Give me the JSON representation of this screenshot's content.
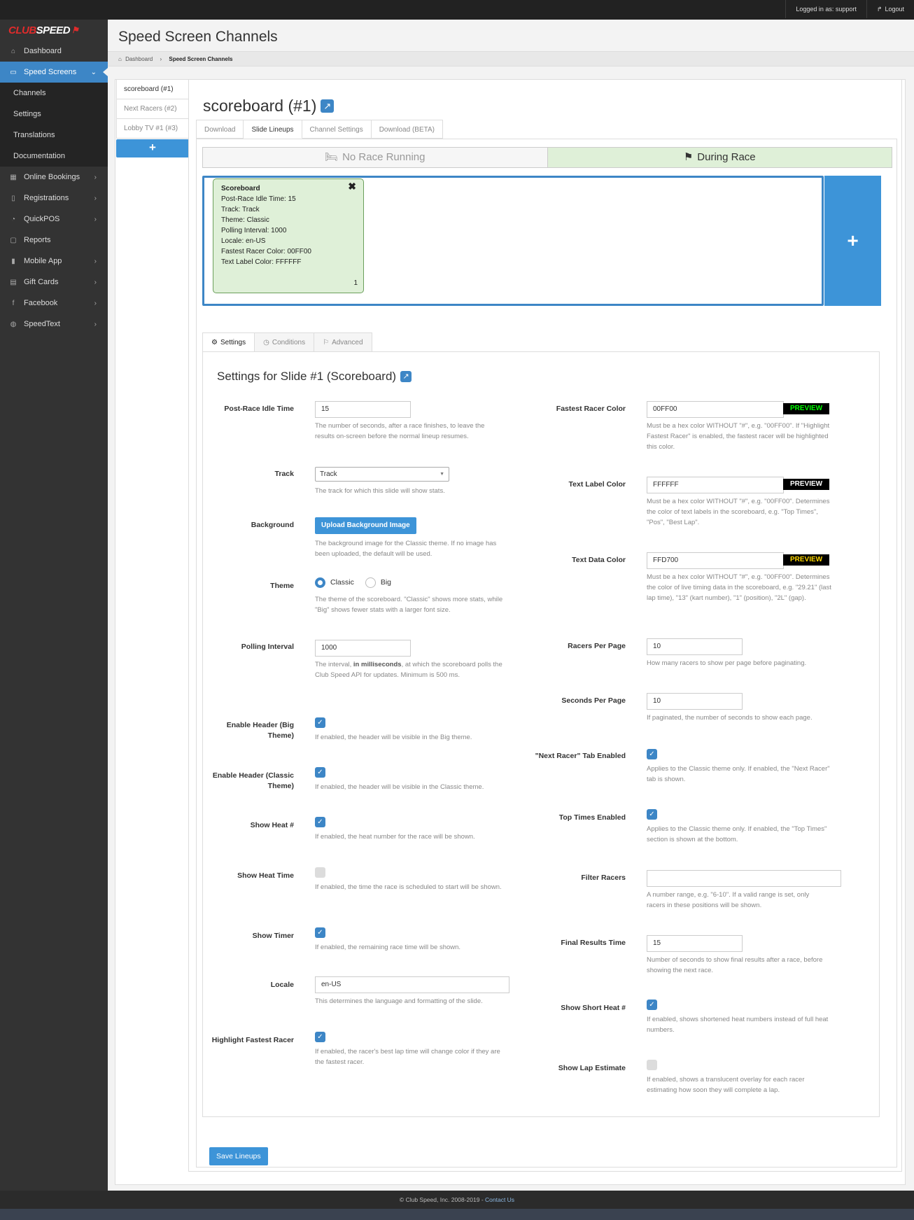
{
  "topbar": {
    "logged_in": "Logged in as: support",
    "logout": "Logout"
  },
  "logo": {
    "part1": "CLUB",
    "part2": "SPEED"
  },
  "sidebar": {
    "items": [
      {
        "label": "Dashboard",
        "icon": "home-icon",
        "glyph": "⌂"
      },
      {
        "label": "Speed Screens",
        "icon": "monitor-icon",
        "glyph": "▭"
      },
      {
        "label": "Channels"
      },
      {
        "label": "Settings"
      },
      {
        "label": "Translations"
      },
      {
        "label": "Documentation"
      },
      {
        "label": "Online Bookings",
        "icon": "calendar-icon",
        "glyph": "▦"
      },
      {
        "label": "Registrations",
        "icon": "tablet-icon",
        "glyph": "▯"
      },
      {
        "label": "QuickPOS",
        "icon": "dashboard-icon",
        "glyph": "◔"
      },
      {
        "label": "Reports",
        "icon": "file-icon",
        "glyph": "▢"
      },
      {
        "label": "Mobile App",
        "icon": "mobile-icon",
        "glyph": "▮"
      },
      {
        "label": "Gift Cards",
        "icon": "gift-card-icon",
        "glyph": "▤"
      },
      {
        "label": "Facebook",
        "icon": "facebook-icon",
        "glyph": "f"
      },
      {
        "label": "SpeedText",
        "icon": "chat-icon",
        "glyph": "◍"
      }
    ]
  },
  "page": {
    "title": "Speed Screen Channels"
  },
  "breadcrumb": {
    "home": "Dashboard",
    "current": "Speed Screen Channels"
  },
  "channels": [
    {
      "label": "scoreboard (#1)"
    },
    {
      "label": "Next Racers (#2)"
    },
    {
      "label": "Lobby TV #1 (#3)"
    }
  ],
  "channel": {
    "title": "scoreboard (#1)"
  },
  "subtabs": [
    "Download",
    "Slide Lineups",
    "Channel Settings",
    "Download (BETA)"
  ],
  "toggle": {
    "no_race": "No Race Running",
    "during": "During Race"
  },
  "card": {
    "title": "Scoreboard",
    "lines": [
      "Post-Race Idle Time: 15",
      "Track: Track",
      "Theme: Classic",
      "Polling Interval: 1000",
      "Locale: en-US",
      "Fastest Racer Color: 00FF00",
      "Text Label Color: FFFFFF"
    ],
    "number": "1"
  },
  "settings_tabs": [
    "Settings",
    "Conditions",
    "Advanced"
  ],
  "settings": {
    "title": "Settings for Slide #1 (Scoreboard)",
    "post_race_idle": {
      "label": "Post-Race Idle Time",
      "value": "15",
      "help": "The number of seconds, after a race finishes, to leave the results on-screen before the normal lineup resumes."
    },
    "track": {
      "label": "Track",
      "value": "Track",
      "help": "The track for which this slide will show stats."
    },
    "background": {
      "label": "Background",
      "button": "Upload Background Image",
      "help": "The background image for the Classic theme. If no image has been uploaded, the default will be used."
    },
    "theme": {
      "label": "Theme",
      "opt1": "Classic",
      "opt2": "Big",
      "help": "The theme of the scoreboard. \"Classic\" shows more stats, while \"Big\" shows fewer stats with a larger font size."
    },
    "polling": {
      "label": "Polling Interval",
      "value": "1000",
      "help1": "The interval, ",
      "help_bold": "in milliseconds",
      "help2": ", at which the scoreboard polls the Club Speed API for updates. Minimum is 500 ms."
    },
    "header_big": {
      "label": "Enable Header (Big Theme)",
      "help": "If enabled, the header will be visible in the Big theme."
    },
    "header_classic": {
      "label": "Enable Header (Classic Theme)",
      "help": "If enabled, the header will be visible in the Classic theme."
    },
    "show_heat": {
      "label": "Show Heat #",
      "help": "If enabled, the heat number for the race will be shown."
    },
    "show_heat_time": {
      "label": "Show Heat Time",
      "help": "If enabled, the time the race is scheduled to start will be shown."
    },
    "show_timer": {
      "label": "Show Timer",
      "help": "If enabled, the remaining race time will be shown."
    },
    "locale": {
      "label": "Locale",
      "value": "en-US",
      "help": "This determines the language and formatting of the slide."
    },
    "highlight": {
      "label": "Highlight Fastest Racer",
      "help": "If enabled, the racer's best lap time will change color if they are the fastest racer."
    },
    "fastest_color": {
      "label": "Fastest Racer Color",
      "value": "00FF00",
      "preview": "PREVIEW",
      "preview_color": "#00ff00",
      "help": "Must be a hex color WITHOUT \"#\", e.g. \"00FF00\". If \"Highlight Fastest Racer\" is enabled, the fastest racer will be highlighted this color."
    },
    "label_color": {
      "label": "Text Label Color",
      "value": "FFFFFF",
      "preview": "PREVIEW",
      "preview_color": "#ffffff",
      "help": "Must be a hex color WITHOUT \"#\", e.g. \"00FF00\". Determines the color of text labels in the scoreboard, e.g. \"Top Times\", \"Pos\", \"Best Lap\"."
    },
    "data_color": {
      "label": "Text Data Color",
      "value": "FFD700",
      "preview": "PREVIEW",
      "preview_color": "#ffd700",
      "help": "Must be a hex color WITHOUT \"#\", e.g. \"00FF00\". Determines the color of live timing data in the scoreboard, e.g. \"29.21\" (last lap time), \"13\" (kart number), \"1\" (position), \"2L\" (gap)."
    },
    "racers_per_page": {
      "label": "Racers Per Page",
      "value": "10",
      "help": "How many racers to show per page before paginating."
    },
    "seconds_per_page": {
      "label": "Seconds Per Page",
      "value": "10",
      "help": "If paginated, the number of seconds to show each page."
    },
    "next_racer_tab": {
      "label": "\"Next Racer\" Tab Enabled",
      "help": "Applies to the Classic theme only. If enabled, the \"Next Racer\" tab is shown."
    },
    "top_times": {
      "label": "Top Times Enabled",
      "help": "Applies to the Classic theme only. If enabled, the \"Top Times\" section is shown at the bottom."
    },
    "filter_racers": {
      "label": "Filter Racers",
      "value": "",
      "help": "A number range, e.g. \"6-10\". If a valid range is set, only racers in these positions will be shown."
    },
    "final_results": {
      "label": "Final Results Time",
      "value": "15",
      "help": "Number of seconds to show final results after a race, before showing the next race."
    },
    "short_heat": {
      "label": "Show Short Heat #",
      "help": "If enabled, shows shortened heat numbers instead of full heat numbers."
    },
    "lap_estimate": {
      "label": "Show Lap Estimate",
      "help": "If enabled, shows a translucent overlay for each racer estimating how soon they will complete a lap."
    }
  },
  "save_button": "Save Lineups",
  "footer": {
    "copyright": "Club Speed, Inc.",
    "years": "2008-2019",
    "sep": " - ",
    "contact": "Contact Us"
  },
  "colors": {
    "accent": "#3d86c6",
    "active_green": "#dff0d8"
  }
}
